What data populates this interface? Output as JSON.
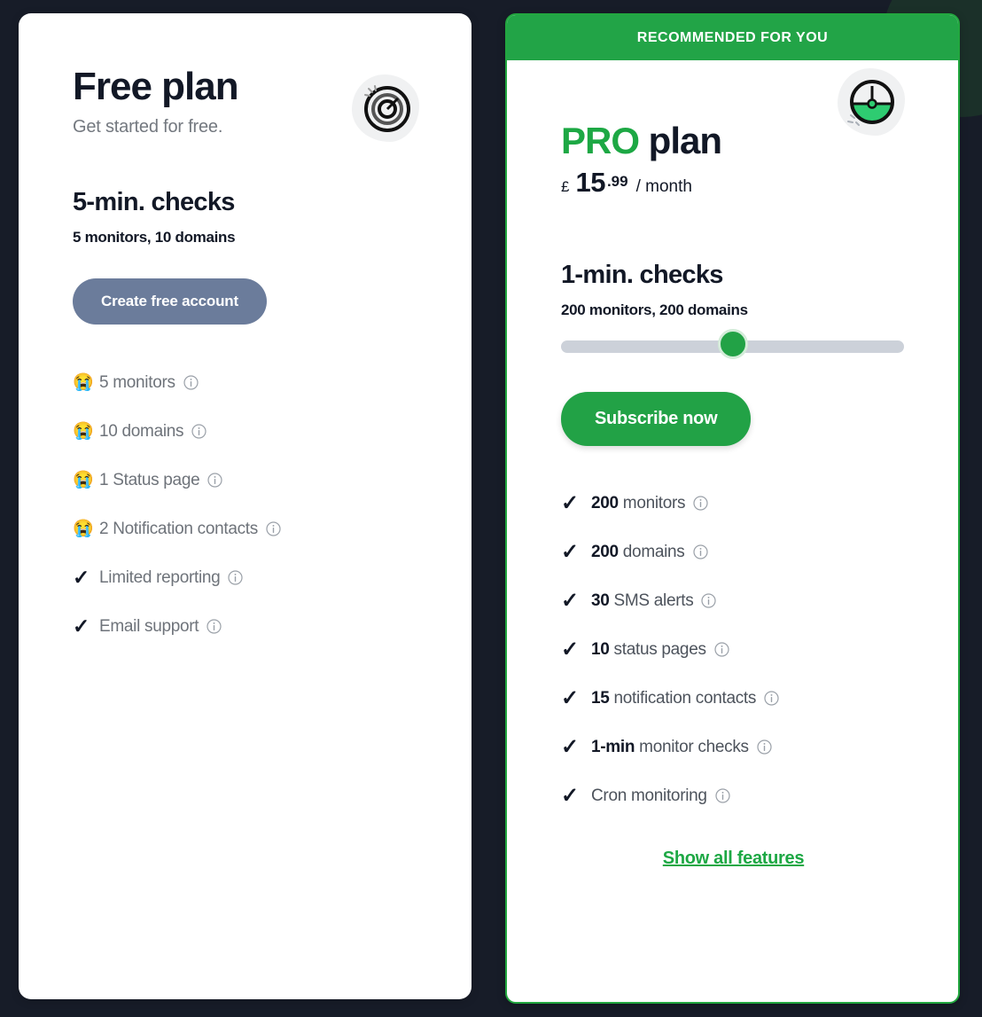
{
  "theme": {
    "page_background": "#171c28",
    "brand_green": "#22a246",
    "free_button": "#6b7c9b",
    "text_dark": "#121826",
    "text_muted": "#6e737a",
    "slider_track": "#ccd1d9"
  },
  "free_plan": {
    "title": "Free plan",
    "subtitle": "Get started for free.",
    "icon": "target-icon",
    "checks_heading": "5-min. checks",
    "checks_subheading": "5 monitors, 10 domains",
    "cta_label": "Create free account",
    "features": [
      {
        "mark": "sad-emoji",
        "glyph": "😭",
        "bold": "",
        "text": "5 monitors",
        "info": "info-icon"
      },
      {
        "mark": "sad-emoji",
        "glyph": "😭",
        "bold": "",
        "text": "10 domains",
        "info": "info-icon"
      },
      {
        "mark": "sad-emoji",
        "glyph": "😭",
        "bold": "",
        "text": "1 Status page",
        "info": "info-icon"
      },
      {
        "mark": "sad-emoji",
        "glyph": "😭",
        "bold": "",
        "text": "2 Notification contacts",
        "info": "info-icon"
      },
      {
        "mark": "check",
        "glyph": "✓",
        "bold": "",
        "text": "Limited reporting",
        "info": "info-icon"
      },
      {
        "mark": "check",
        "glyph": "✓",
        "bold": "",
        "text": "Email support",
        "info": "info-icon"
      }
    ]
  },
  "pro_plan": {
    "ribbon_label": "RECOMMENDED FOR YOU",
    "title_highlight": "PRO",
    "title_rest": " plan",
    "icon": "speedometer-icon",
    "price": {
      "currency": "£",
      "whole": "15",
      "decimal": ".99",
      "period": "/ month"
    },
    "checks_heading": "1-min. checks",
    "checks_subheading": "200 monitors, 200 domains",
    "slider": {
      "value_percent": 50
    },
    "cta_label": "Subscribe now",
    "features": [
      {
        "mark": "check",
        "glyph": "✓",
        "bold": "200",
        "text": " monitors",
        "info": "info-icon"
      },
      {
        "mark": "check",
        "glyph": "✓",
        "bold": "200",
        "text": " domains",
        "info": "info-icon"
      },
      {
        "mark": "check",
        "glyph": "✓",
        "bold": "30",
        "text": " SMS alerts",
        "info": "info-icon"
      },
      {
        "mark": "check",
        "glyph": "✓",
        "bold": "10",
        "text": " status pages",
        "info": "info-icon"
      },
      {
        "mark": "check",
        "glyph": "✓",
        "bold": "15",
        "text": " notification contacts",
        "info": "info-icon"
      },
      {
        "mark": "check",
        "glyph": "✓",
        "bold": "1-min",
        "text": " monitor checks",
        "info": "info-icon"
      },
      {
        "mark": "check",
        "glyph": "✓",
        "bold": "",
        "text": "Cron monitoring",
        "info": "info-icon"
      }
    ],
    "show_all_label": "Show all features"
  }
}
